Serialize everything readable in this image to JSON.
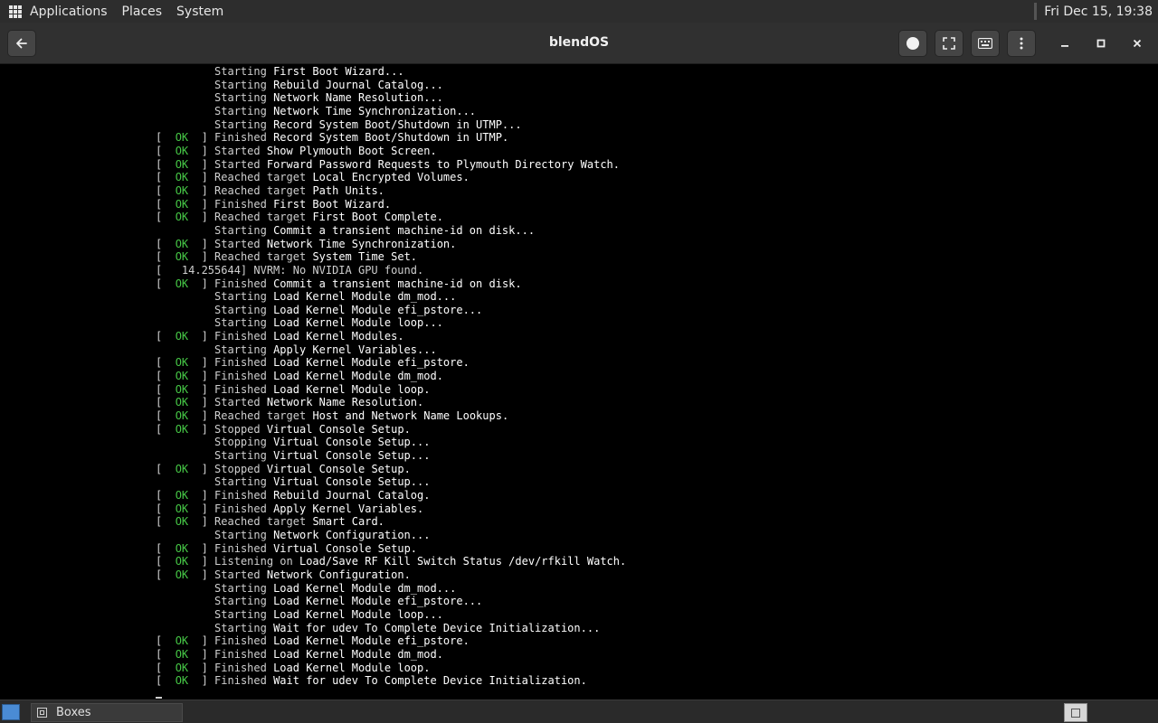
{
  "top_panel": {
    "menus": [
      "Applications",
      "Places",
      "System"
    ],
    "clock": "Fri Dec 15, 19:38"
  },
  "window": {
    "title": "blendOS",
    "buttons": {
      "back": "arrow-left-icon",
      "record": "record-dot-icon",
      "fullscreen": "fullscreen-icon",
      "keyboard": "keyboard-icon",
      "menu": "vertical-dots-icon",
      "minimize": "minimize-icon",
      "maximize": "maximize-icon",
      "close": "close-icon"
    }
  },
  "console": {
    "lines": [
      {
        "status": "",
        "verb": "Starting",
        "text": "First Boot Wizard..."
      },
      {
        "status": "",
        "verb": "Starting",
        "text": "Rebuild Journal Catalog..."
      },
      {
        "status": "",
        "verb": "Starting",
        "text": "Network Name Resolution..."
      },
      {
        "status": "",
        "verb": "Starting",
        "text": "Network Time Synchronization..."
      },
      {
        "status": "",
        "verb": "Starting",
        "text": "Record System Boot/Shutdown in UTMP..."
      },
      {
        "status": "OK",
        "verb": "Finished",
        "text": "Record System Boot/Shutdown in UTMP."
      },
      {
        "status": "OK",
        "verb": "Started",
        "text": "Show Plymouth Boot Screen."
      },
      {
        "status": "OK",
        "verb": "Started",
        "text": "Forward Password Requests to Plymouth Directory Watch."
      },
      {
        "status": "OK",
        "verb": "Reached target",
        "text": "Local Encrypted Volumes."
      },
      {
        "status": "OK",
        "verb": "Reached target",
        "text": "Path Units."
      },
      {
        "status": "OK",
        "verb": "Finished",
        "text": "First Boot Wizard."
      },
      {
        "status": "OK",
        "verb": "Reached target",
        "text": "First Boot Complete."
      },
      {
        "status": "",
        "verb": "Starting",
        "text": "Commit a transient machine-id on disk..."
      },
      {
        "status": "OK",
        "verb": "Started",
        "text": "Network Time Synchronization."
      },
      {
        "status": "OK",
        "verb": "Reached target",
        "text": "System Time Set."
      },
      {
        "status": "RAW",
        "verb": "",
        "text": "[   14.255644] NVRM: No NVIDIA GPU found."
      },
      {
        "status": "OK",
        "verb": "Finished",
        "text": "Commit a transient machine-id on disk."
      },
      {
        "status": "",
        "verb": "Starting",
        "text": "Load Kernel Module dm_mod..."
      },
      {
        "status": "",
        "verb": "Starting",
        "text": "Load Kernel Module efi_pstore..."
      },
      {
        "status": "",
        "verb": "Starting",
        "text": "Load Kernel Module loop..."
      },
      {
        "status": "OK",
        "verb": "Finished",
        "text": "Load Kernel Modules."
      },
      {
        "status": "",
        "verb": "Starting",
        "text": "Apply Kernel Variables..."
      },
      {
        "status": "OK",
        "verb": "Finished",
        "text": "Load Kernel Module efi_pstore."
      },
      {
        "status": "OK",
        "verb": "Finished",
        "text": "Load Kernel Module dm_mod."
      },
      {
        "status": "OK",
        "verb": "Finished",
        "text": "Load Kernel Module loop."
      },
      {
        "status": "OK",
        "verb": "Started",
        "text": "Network Name Resolution."
      },
      {
        "status": "OK",
        "verb": "Reached target",
        "text": "Host and Network Name Lookups."
      },
      {
        "status": "OK",
        "verb": "Stopped",
        "text": "Virtual Console Setup."
      },
      {
        "status": "",
        "verb": "Stopping",
        "text": "Virtual Console Setup..."
      },
      {
        "status": "",
        "verb": "Starting",
        "text": "Virtual Console Setup..."
      },
      {
        "status": "OK",
        "verb": "Stopped",
        "text": "Virtual Console Setup."
      },
      {
        "status": "",
        "verb": "Starting",
        "text": "Virtual Console Setup..."
      },
      {
        "status": "OK",
        "verb": "Finished",
        "text": "Rebuild Journal Catalog."
      },
      {
        "status": "OK",
        "verb": "Finished",
        "text": "Apply Kernel Variables."
      },
      {
        "status": "OK",
        "verb": "Reached target",
        "text": "Smart Card."
      },
      {
        "status": "",
        "verb": "Starting",
        "text": "Network Configuration..."
      },
      {
        "status": "OK",
        "verb": "Finished",
        "text": "Virtual Console Setup."
      },
      {
        "status": "OK",
        "verb": "Listening on",
        "text": "Load/Save RF Kill Switch Status /dev/rfkill Watch."
      },
      {
        "status": "OK",
        "verb": "Started",
        "text": "Network Configuration."
      },
      {
        "status": "",
        "verb": "Starting",
        "text": "Load Kernel Module dm_mod..."
      },
      {
        "status": "",
        "verb": "Starting",
        "text": "Load Kernel Module efi_pstore..."
      },
      {
        "status": "",
        "verb": "Starting",
        "text": "Load Kernel Module loop..."
      },
      {
        "status": "",
        "verb": "Starting",
        "text": "Wait for udev To Complete Device Initialization..."
      },
      {
        "status": "OK",
        "verb": "Finished",
        "text": "Load Kernel Module efi_pstore."
      },
      {
        "status": "OK",
        "verb": "Finished",
        "text": "Load Kernel Module dm_mod."
      },
      {
        "status": "OK",
        "verb": "Finished",
        "text": "Load Kernel Module loop."
      },
      {
        "status": "OK",
        "verb": "Finished",
        "text": "Wait for udev To Complete Device Initialization."
      }
    ]
  },
  "taskbar": {
    "tasks": [
      {
        "label": "Boxes"
      }
    ],
    "show_desktop_icon": "show-desktop-icon",
    "workspace_icon": "workspace-icon"
  },
  "colors": {
    "ok": "#46c846",
    "panel": "#2d2d2d",
    "titlebar": "#303030",
    "console_bg": "#000000"
  }
}
